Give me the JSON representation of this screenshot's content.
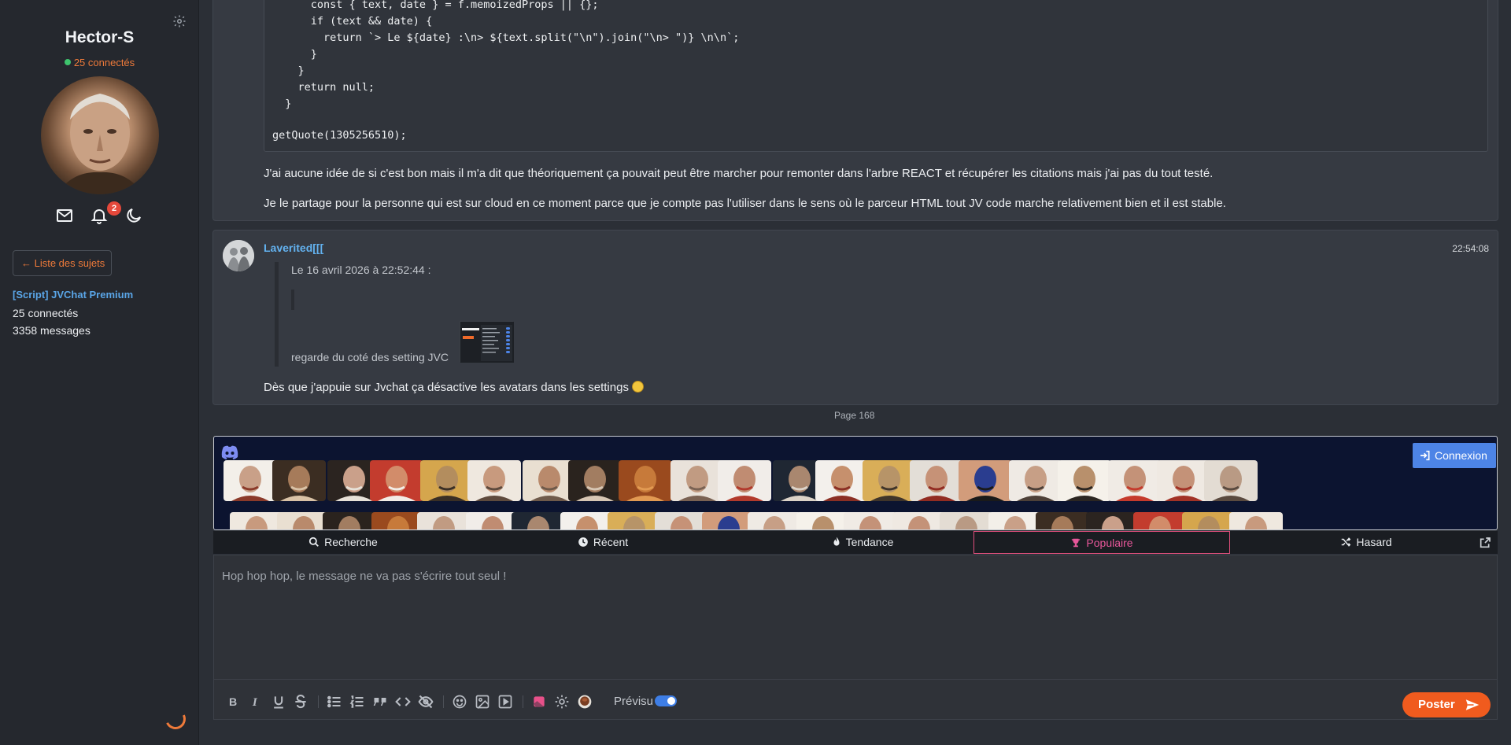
{
  "sidebar": {
    "username": "Hector-S",
    "online": "25 connectés",
    "notif_count": "2",
    "topics_button": "← Liste des sujets",
    "topic_title": "[Script] JVChat Premium",
    "topic_connected": "25 connectés",
    "topic_messages": "3358 messages"
  },
  "post1": {
    "code_lines": [
      "      const { text, date } = f.memoizedProps || {};",
      "      if (text && date) {",
      "        return `> Le ${date} :\\n> ${text.split(\"\\n\").join(\"\\n> \")} \\n\\n`;",
      "      }",
      "    }",
      "    return null;",
      "  }",
      "",
      "getQuote(1305256510);"
    ],
    "paragraph1": "J'ai aucune idée de si c'est bon mais il m'a dit que théoriquement ça pouvait peut être marcher pour remonter dans l'arbre REACT et récupérer les citations mais j'ai pas du tout testé.",
    "paragraph2": "Je le partage pour la personne qui est sur cloud en ce moment parce que je compte pas l'utiliser dans le sens où le parceur HTML tout JV code marche relativement bien et il est stable."
  },
  "post2": {
    "author": "Laverited[[[",
    "time": "22:54:08",
    "quote_meta": "Le 16 avril 2026 à 22:52:44 :",
    "quote_text": "regarde du coté des setting JVC",
    "body": "Dès que j'appuie sur Jvchat ça désactive les avatars dans les settings"
  },
  "page_label": "Page 168",
  "sticker_panel": {
    "connexion": "Connexion"
  },
  "tabs": {
    "recherche": "Recherche",
    "recent": "Récent",
    "tendance": "Tendance",
    "populaire": "Populaire",
    "hasard": "Hasard"
  },
  "editor": {
    "placeholder": "Hop hop hop, le message ne va pas s'écrire tout seul !",
    "previsu": "Prévisu",
    "previsu_enabled": true,
    "post_button": "Poster"
  },
  "colors": {
    "accent": "#ee7a3a",
    "link": "#63b2f0",
    "active_tab": "#e7579a",
    "poster": "#f05b1e",
    "connexion": "#4d84e6"
  }
}
